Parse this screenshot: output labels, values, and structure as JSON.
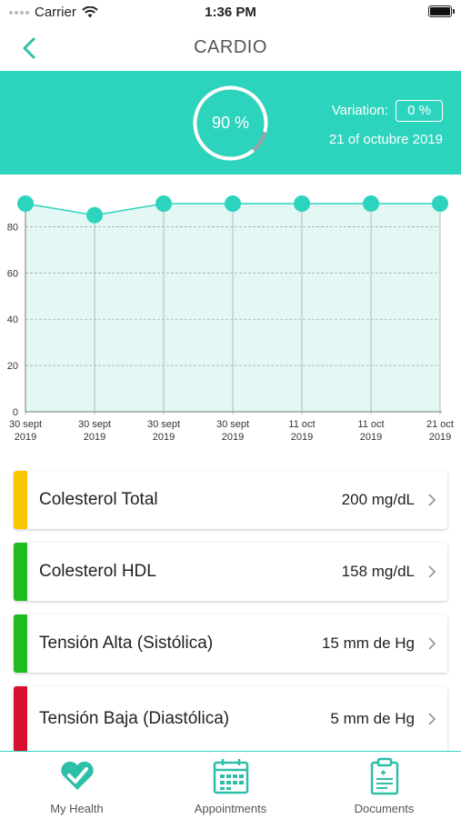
{
  "status": {
    "carrier": "Carrier",
    "time": "1:36 PM"
  },
  "nav": {
    "title": "CARDIO"
  },
  "summary": {
    "percent": "90 %",
    "percent_value": 0.9,
    "variation_label": "Variation:",
    "variation_value": "0 %",
    "date": "21 of octubre 2019"
  },
  "colors": {
    "accent": "#2dd4bd",
    "yellow": "#f9c400",
    "green": "#1ebc1e",
    "red": "#d6102e"
  },
  "chart_data": {
    "type": "area",
    "x": [
      "30 sept 2019",
      "30 sept 2019",
      "30 sept 2019",
      "30 sept 2019",
      "11 oct 2019",
      "11 oct 2019",
      "21 oct 2019"
    ],
    "x_labels": [
      [
        "30 sept",
        "2019"
      ],
      [
        "30 sept",
        "2019"
      ],
      [
        "30 sept",
        "2019"
      ],
      [
        "30 sept",
        "2019"
      ],
      [
        "11 oct",
        "2019"
      ],
      [
        "11 oct",
        "2019"
      ],
      [
        "21 oct",
        "2019"
      ]
    ],
    "values": [
      90,
      85,
      90,
      90,
      90,
      90,
      90
    ],
    "ylim": [
      0,
      90
    ],
    "yticks": [
      0,
      20,
      40,
      60,
      80
    ],
    "grid": true
  },
  "metrics": [
    {
      "name": "Colesterol Total",
      "value": "200 mg/dL",
      "status": "yellow"
    },
    {
      "name": "Colesterol HDL",
      "value": "158 mg/dL",
      "status": "green"
    },
    {
      "name": "Tensión Alta (Sistólica)",
      "value": "15 mm de Hg",
      "status": "green"
    },
    {
      "name": "Tensión Baja (Diastólica)",
      "value": "5 mm de Hg",
      "status": "red"
    }
  ],
  "tabs": [
    {
      "label": "My Health",
      "icon": "heart-check-icon"
    },
    {
      "label": "Appointments",
      "icon": "calendar-icon"
    },
    {
      "label": "Documents",
      "icon": "clipboard-icon"
    }
  ]
}
